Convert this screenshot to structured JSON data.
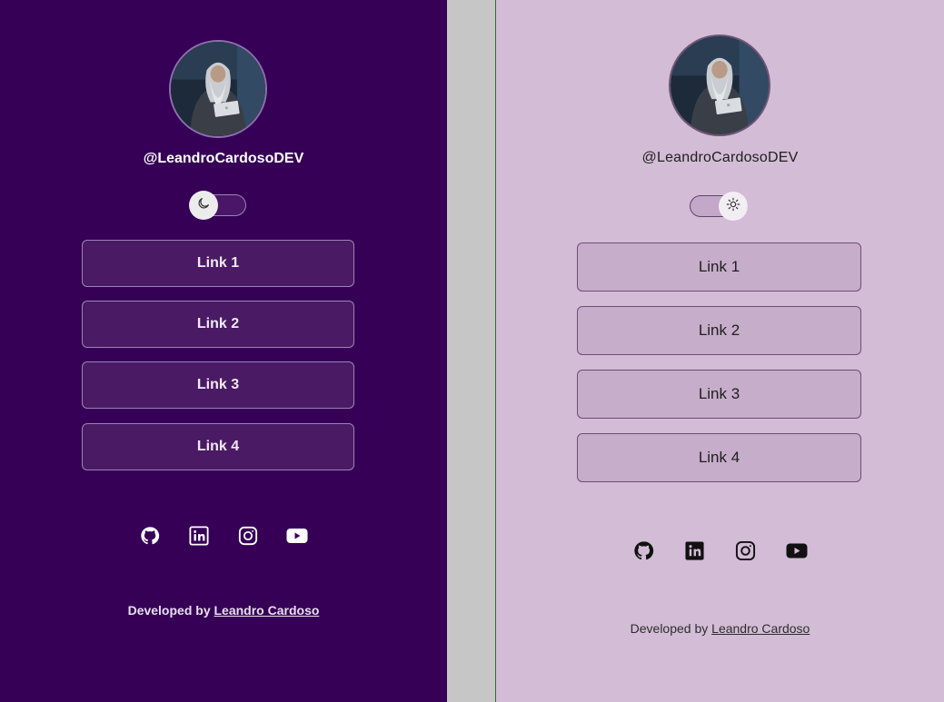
{
  "dark_panel": {
    "handle": "@LeandroCardosoDEV",
    "theme": "dark",
    "links": [
      {
        "label": "Link 1"
      },
      {
        "label": "Link 2"
      },
      {
        "label": "Link 3"
      },
      {
        "label": "Link 4"
      }
    ],
    "socials": [
      "github-icon",
      "linkedin-icon",
      "instagram-icon",
      "youtube-icon"
    ],
    "footer_prefix": "Developed by",
    "footer_link": "Leandro Cardoso"
  },
  "light_panel": {
    "handle": "@LeandroCardosoDEV",
    "theme": "light",
    "links": [
      {
        "label": "Link 1"
      },
      {
        "label": "Link 2"
      },
      {
        "label": "Link 3"
      },
      {
        "label": "Link 4"
      }
    ],
    "socials": [
      "github-icon",
      "linkedin-icon",
      "instagram-icon",
      "youtube-icon"
    ],
    "footer_prefix": "Developed by",
    "footer_link": "Leandro Cardoso"
  },
  "colors": {
    "dark_background": "#350056",
    "dark_button": "#4a1a64",
    "light_background": "#d3bcd6",
    "light_button": "#c6adca",
    "divider_gray": "#c6c6c6"
  }
}
